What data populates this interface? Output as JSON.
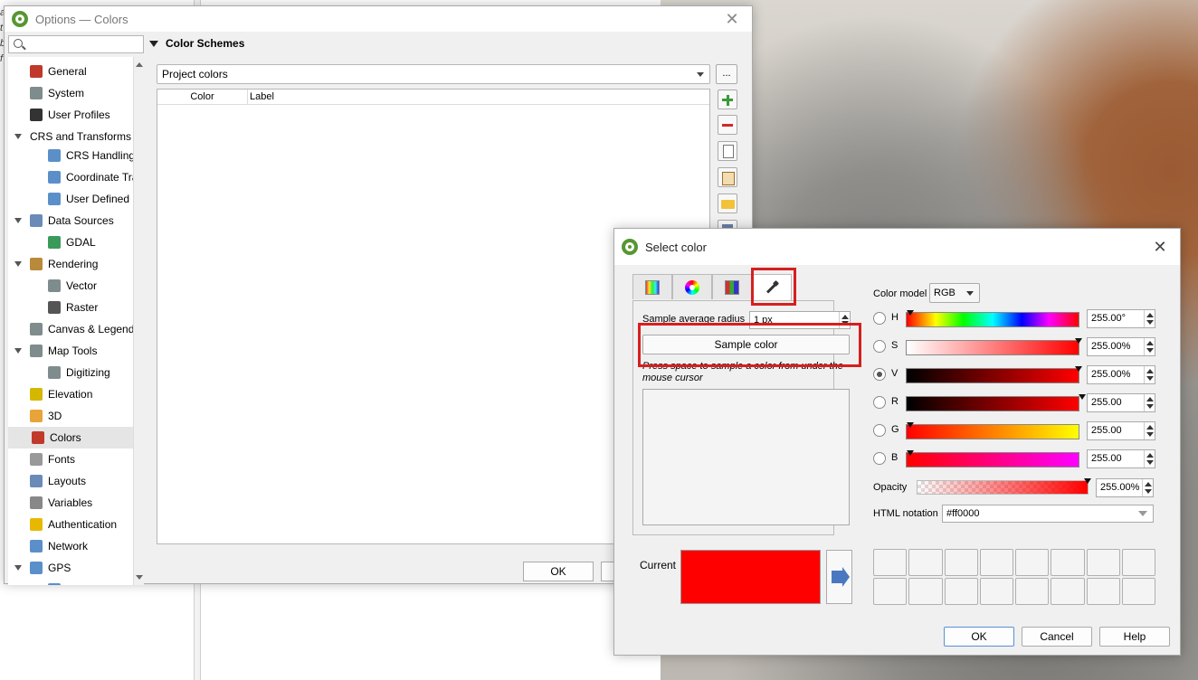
{
  "background": {
    "left_fragments": [
      "a",
      "t",
      "b",
      "f",
      "",
      "",
      "",
      "is",
      "",
      "",
      "",
      "a",
      "a",
      "a",
      "",
      "",
      "",
      "",
      "",
      "",
      "",
      "",
      ""
    ]
  },
  "options_window": {
    "title": "Options — Colors",
    "search_placeholder": "",
    "section_title": "Color Schemes",
    "scheme_value": "Project colors",
    "more_label": "...",
    "table_headers": [
      "Color",
      "Label"
    ],
    "ok_label": "OK",
    "tree": [
      {
        "label": "General",
        "level": 0,
        "icon": "wrench-icon",
        "color": "#c0392b"
      },
      {
        "label": "System",
        "level": 0,
        "icon": "gear-icon",
        "color": "#7f8c8d"
      },
      {
        "label": "User Profiles",
        "level": 0,
        "icon": "user-icon",
        "color": "#333333"
      },
      {
        "label": "CRS and Transforms",
        "level": 0,
        "icon": "none",
        "color": "",
        "expandable": true
      },
      {
        "label": "CRS Handling",
        "level": 1,
        "icon": "globe-icon",
        "color": "#5b8fc9"
      },
      {
        "label": "Coordinate Tra",
        "level": 1,
        "icon": "globe-icon",
        "color": "#5b8fc9"
      },
      {
        "label": "User Defined C",
        "level": 1,
        "icon": "globe-star-icon",
        "color": "#5b8fc9"
      },
      {
        "label": "Data Sources",
        "level": 0,
        "icon": "table-icon",
        "color": "#6a8bb8",
        "expandable": true
      },
      {
        "label": "GDAL",
        "level": 1,
        "icon": "globe-icon",
        "color": "#3a9a5a"
      },
      {
        "label": "Rendering",
        "level": 0,
        "icon": "brush-icon",
        "color": "#b88a3a",
        "expandable": true
      },
      {
        "label": "Vector",
        "level": 1,
        "icon": "vector-icon",
        "color": "#7f8c8d"
      },
      {
        "label": "Raster",
        "level": 1,
        "icon": "raster-icon",
        "color": "#555555"
      },
      {
        "label": "Canvas & Legend",
        "level": 0,
        "icon": "canvas-icon",
        "color": "#7f8c8d"
      },
      {
        "label": "Map Tools",
        "level": 0,
        "icon": "map-tools-icon",
        "color": "#7f8c8d",
        "expandable": true
      },
      {
        "label": "Digitizing",
        "level": 1,
        "icon": "digitizing-icon",
        "color": "#7f8c8d"
      },
      {
        "label": "Elevation",
        "level": 0,
        "icon": "elevation-icon",
        "color": "#d4b800"
      },
      {
        "label": "3D",
        "level": 0,
        "icon": "cube-icon",
        "color": "#e8a33a"
      },
      {
        "label": "Colors",
        "level": 0,
        "icon": "colors-icon",
        "color": "#c0392b",
        "selected": true
      },
      {
        "label": "Fonts",
        "level": 0,
        "icon": "font-icon",
        "color": "#999999"
      },
      {
        "label": "Layouts",
        "level": 0,
        "icon": "layout-icon",
        "color": "#6a8bb8"
      },
      {
        "label": "Variables",
        "level": 0,
        "icon": "variables-icon",
        "color": "#888888"
      },
      {
        "label": "Authentication",
        "level": 0,
        "icon": "lock-icon",
        "color": "#e8b800"
      },
      {
        "label": "Network",
        "level": 0,
        "icon": "network-icon",
        "color": "#5b8fc9"
      },
      {
        "label": "GPS",
        "level": 0,
        "icon": "gps-icon",
        "color": "#5b8fc9",
        "expandable": true
      },
      {
        "label": "GPSBabel",
        "level": 1,
        "icon": "gps-icon",
        "color": "#5b8fc9"
      }
    ]
  },
  "select_color": {
    "title": "Select color",
    "tabs": [
      "ramp-tab",
      "wheel-tab",
      "grid-tab",
      "picker-tab"
    ],
    "active_tab": 3,
    "sample_radius_label": "Sample average radius",
    "sample_radius_value": "1 px",
    "sample_button": "Sample color",
    "sample_hint": "Press space to sample a color from under the mouse cursor",
    "current_label": "Current",
    "current_color": "#ff0000",
    "color_model_label": "Color model",
    "color_model_value": "RGB",
    "components": [
      {
        "letter": "H",
        "value": "255.00°",
        "checked": false
      },
      {
        "letter": "S",
        "value": "255.00%",
        "checked": false
      },
      {
        "letter": "V",
        "value": "255.00%",
        "checked": true
      },
      {
        "letter": "R",
        "value": "255.00",
        "checked": false
      },
      {
        "letter": "G",
        "value": "255.00",
        "checked": false
      },
      {
        "letter": "B",
        "value": "255.00",
        "checked": false
      }
    ],
    "opacity_label": "Opacity",
    "opacity_value": "255.00%",
    "html_label": "HTML notation",
    "html_value": "#ff0000",
    "buttons": {
      "ok": "OK",
      "cancel": "Cancel",
      "help": "Help"
    },
    "highlight_color": "#d61f1f"
  }
}
